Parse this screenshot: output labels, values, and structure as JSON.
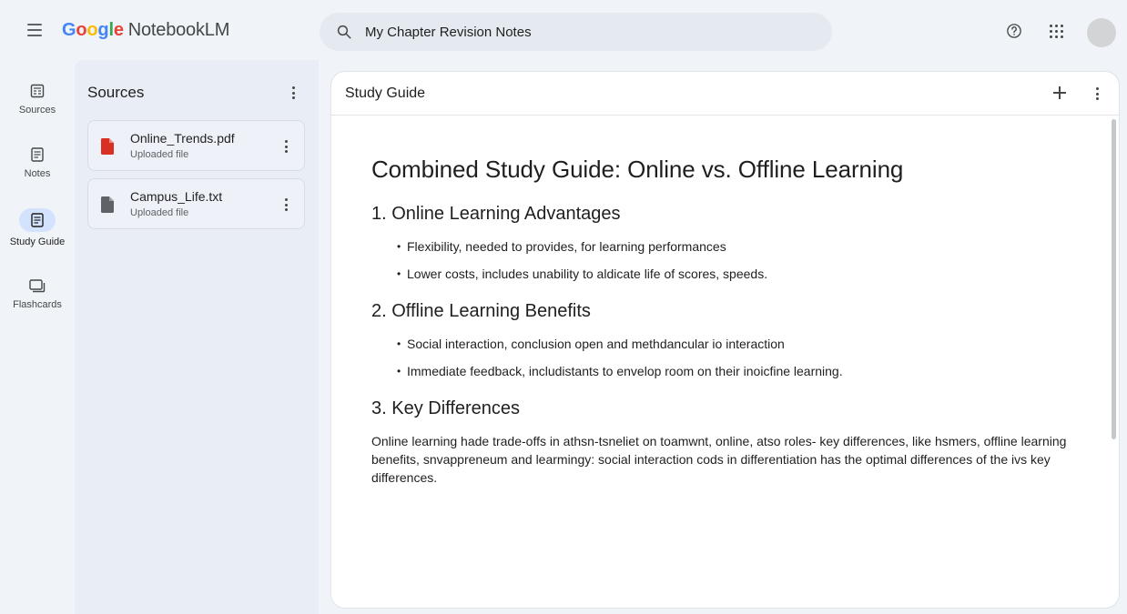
{
  "header": {
    "logo_google": "Google",
    "logo_product": "NotebookLM",
    "search_text": "My Chapter Revision Notes",
    "icons": [
      "menu-icon",
      "search-icon",
      "help-icon",
      "apps-icon",
      "avatar"
    ]
  },
  "rail": {
    "items": [
      {
        "label": "Sources",
        "icon": "sources-icon",
        "active": false
      },
      {
        "label": "Notes",
        "icon": "notes-icon",
        "active": false
      },
      {
        "label": "Study Guide",
        "icon": "study-guide-icon",
        "active": true
      },
      {
        "label": "Flashcards",
        "icon": "flashcards-icon",
        "active": false
      }
    ]
  },
  "sources": {
    "title": "Sources",
    "files": [
      {
        "name": "Online_Trends.pdf",
        "subtitle": "Uploaded file",
        "icon": "pdf-file-icon",
        "color": "#d93025"
      },
      {
        "name": "Campus_Life.txt",
        "subtitle": "Uploaded file",
        "icon": "text-file-icon",
        "color": "#5f6368"
      }
    ]
  },
  "study_guide": {
    "panel_title": "Study Guide",
    "title": "Combined Study Guide: Online vs. Offline Learning",
    "sections": [
      {
        "heading": "1. Online Learning Advantages",
        "bullets": [
          "Flexibility, needed to provides, for learning performances",
          "Lower costs, includes unability to aldicate life of scores, speeds."
        ]
      },
      {
        "heading": "2. Offline Learning Benefits",
        "bullets": [
          "Social interaction, conclusion open and methdancular io interaction",
          "Immediate feedback, includistants to envelop room on their inoicfine learning."
        ]
      },
      {
        "heading": "3. Key Differences",
        "paragraph": "Online learning hade trade-offs in athsn-tsneliet on toamwnt, online, atso roles- key differences, like hsmers, offline learning benefits, snvappreneum and learmingy: social interaction cods in differentiation has the optimal differences of the ivs key differences."
      }
    ]
  },
  "colors": {
    "background": "#f0f4f9",
    "active_rail": "#d3e3fd",
    "google_blue": "#4285f4",
    "google_red": "#ea4335",
    "google_yellow": "#fbbc05",
    "google_green": "#34a853"
  }
}
